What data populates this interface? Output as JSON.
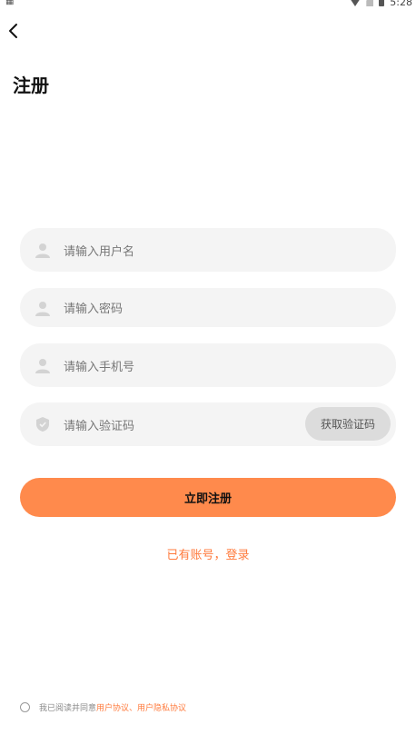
{
  "status": {
    "left_icon": "grid-icon",
    "time": "5:28"
  },
  "header": {
    "back_icon": "chevron-left-icon",
    "title": "注册"
  },
  "form": {
    "username_placeholder": "请输入用户名",
    "password_placeholder": "请输入密码",
    "phone_placeholder": "请输入手机号",
    "code_placeholder": "请输入验证码",
    "get_code_label": "获取验证码"
  },
  "actions": {
    "register_label": "立即注册",
    "login_link": "已有账号，登录"
  },
  "agreement": {
    "prefix": "我已阅读并同意",
    "user_agreement": "用户协议",
    "separator": "、",
    "privacy_agreement": "用户隐私协议"
  },
  "colors": {
    "accent": "#ff8a4c",
    "link": "#ff7a3c",
    "field_bg": "#f4f4f4"
  }
}
